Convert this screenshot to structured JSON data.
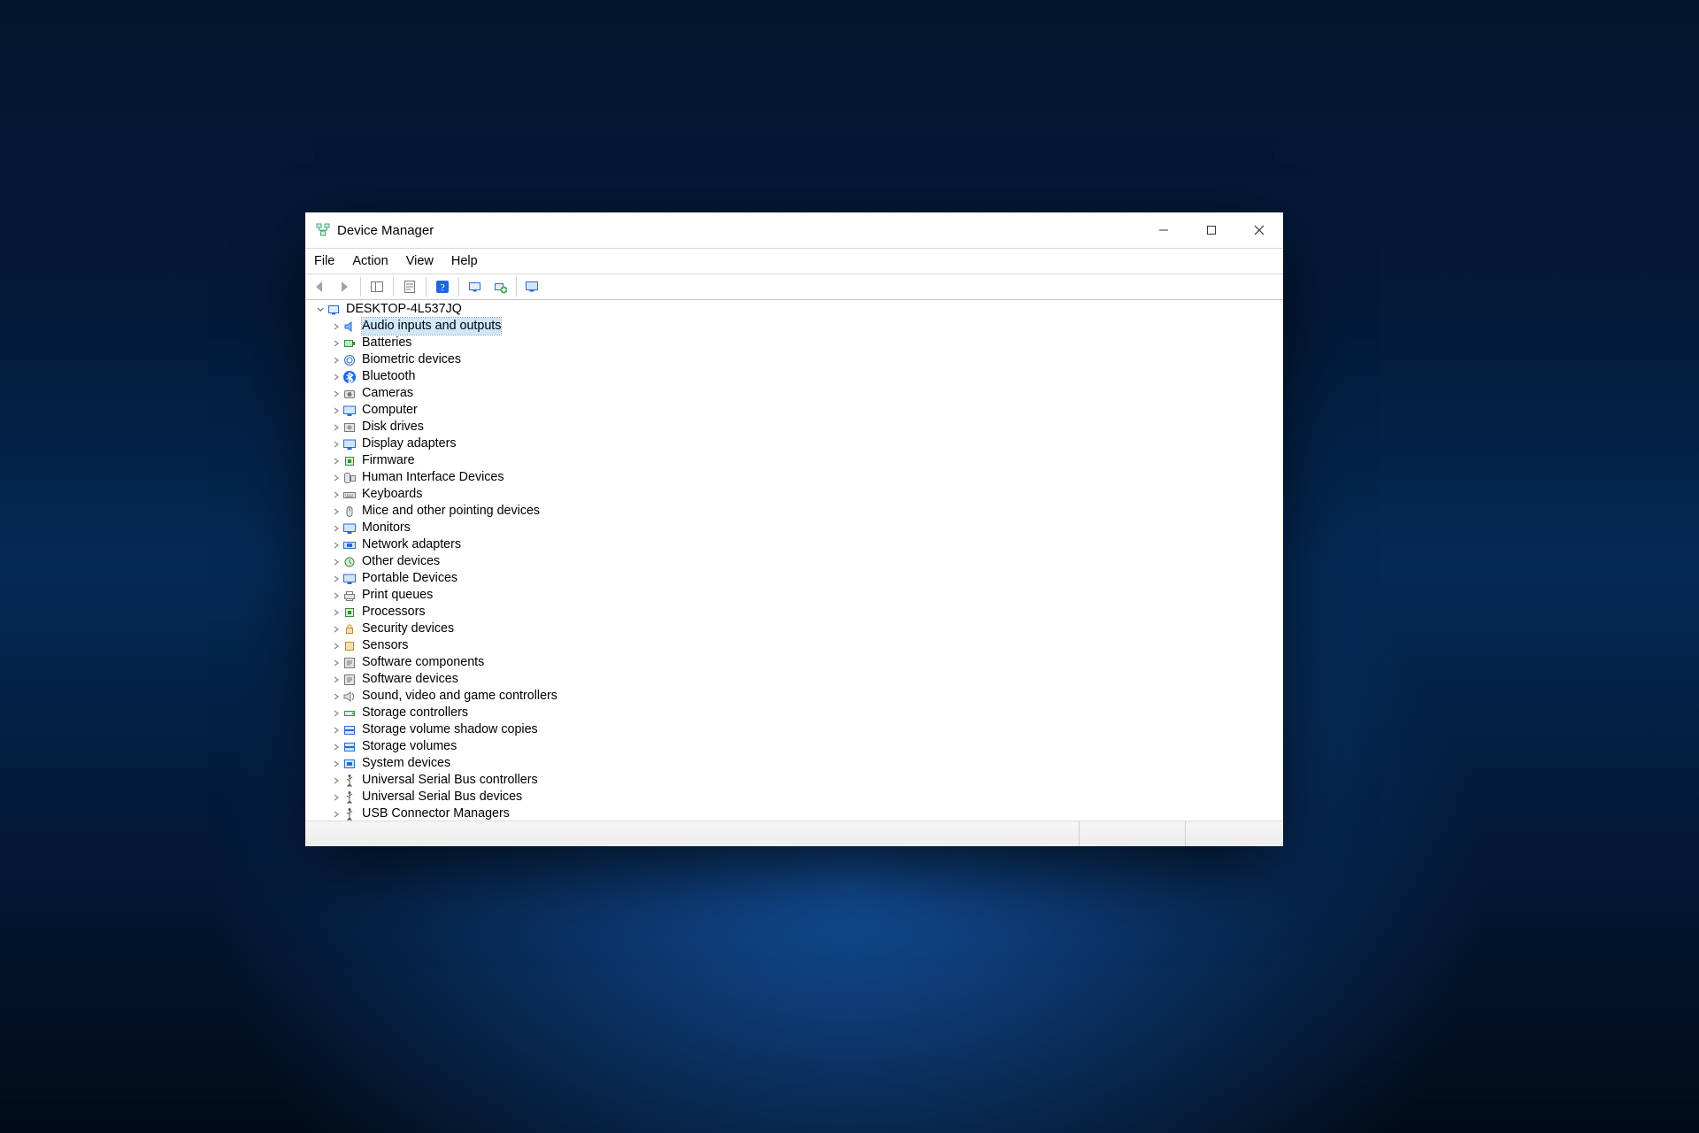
{
  "window": {
    "title": "Device Manager"
  },
  "menus": [
    "File",
    "Action",
    "View",
    "Help"
  ],
  "tree": {
    "root": "DESKTOP-4L537JQ",
    "selected": "Audio inputs and outputs",
    "items": [
      {
        "label": "Audio inputs and outputs",
        "icon": "audio"
      },
      {
        "label": "Batteries",
        "icon": "battery"
      },
      {
        "label": "Biometric devices",
        "icon": "fingerprint"
      },
      {
        "label": "Bluetooth",
        "icon": "bluetooth"
      },
      {
        "label": "Cameras",
        "icon": "camera"
      },
      {
        "label": "Computer",
        "icon": "monitor"
      },
      {
        "label": "Disk drives",
        "icon": "disk"
      },
      {
        "label": "Display adapters",
        "icon": "display"
      },
      {
        "label": "Firmware",
        "icon": "chip"
      },
      {
        "label": "Human Interface Devices",
        "icon": "hid"
      },
      {
        "label": "Keyboards",
        "icon": "keyboard"
      },
      {
        "label": "Mice and other pointing devices",
        "icon": "mouse"
      },
      {
        "label": "Monitors",
        "icon": "monitor2"
      },
      {
        "label": "Network adapters",
        "icon": "network"
      },
      {
        "label": "Other devices",
        "icon": "other"
      },
      {
        "label": "Portable Devices",
        "icon": "portable"
      },
      {
        "label": "Print queues",
        "icon": "printer"
      },
      {
        "label": "Processors",
        "icon": "cpu"
      },
      {
        "label": "Security devices",
        "icon": "security"
      },
      {
        "label": "Sensors",
        "icon": "sensor"
      },
      {
        "label": "Software components",
        "icon": "softcomp"
      },
      {
        "label": "Software devices",
        "icon": "softdev"
      },
      {
        "label": "Sound, video and game controllers",
        "icon": "sound"
      },
      {
        "label": "Storage controllers",
        "icon": "stctrl"
      },
      {
        "label": "Storage volume shadow copies",
        "icon": "shadow"
      },
      {
        "label": "Storage volumes",
        "icon": "storage"
      },
      {
        "label": "System devices",
        "icon": "system"
      },
      {
        "label": "Universal Serial Bus controllers",
        "icon": "usb"
      },
      {
        "label": "Universal Serial Bus devices",
        "icon": "usbdev"
      },
      {
        "label": "USB Connector Managers",
        "icon": "usbconn"
      }
    ]
  }
}
